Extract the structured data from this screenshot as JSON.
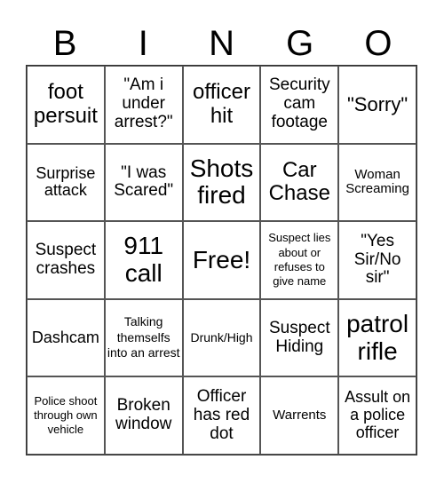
{
  "header": [
    "B",
    "I",
    "N",
    "G",
    "O"
  ],
  "cells": [
    "foot persuit",
    "\"Am i under arrest?\"",
    "officer hit",
    "Security cam footage",
    "\"Sorry\"",
    "Surprise attack",
    "\"I was Scared\"",
    "Shots fired",
    "Car Chase",
    "Woman Screaming",
    "Suspect crashes",
    "911 call",
    "Free!",
    "Suspect lies about or refuses to give name",
    "\"Yes Sir/No sir\"",
    "Dashcam",
    "Talking themselfs into an arrest",
    "Drunk/High",
    "Suspect Hiding",
    "patrol rifle",
    "Police shoot through own vehicle",
    "Broken window",
    "Officer has red dot",
    "Warrents",
    "Assult on a police officer"
  ]
}
